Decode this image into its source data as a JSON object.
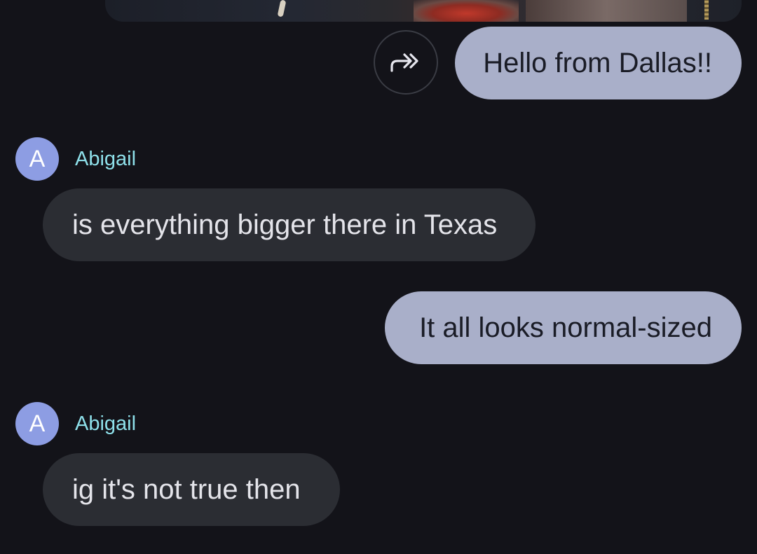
{
  "conversation": {
    "photo_attachment": {
      "icon": "photo-thumbnail"
    },
    "forward_action": {
      "icon": "forward-icon"
    },
    "messages": [
      {
        "direction": "outgoing",
        "text": "Hello from Dallas!!"
      },
      {
        "direction": "incoming",
        "sender": "Abigail",
        "avatar_letter": "A",
        "text": "is everything bigger there in Texas"
      },
      {
        "direction": "outgoing",
        "text": "It all looks normal-sized"
      },
      {
        "direction": "incoming",
        "sender": "Abigail",
        "avatar_letter": "A",
        "text": "ig it's not true then"
      }
    ]
  },
  "colors": {
    "background": "#131319",
    "outgoing_bubble": "#a9afc9",
    "incoming_bubble": "#2b2d33",
    "avatar": "#8d9de3",
    "sender_name": "#8ee0ea"
  }
}
